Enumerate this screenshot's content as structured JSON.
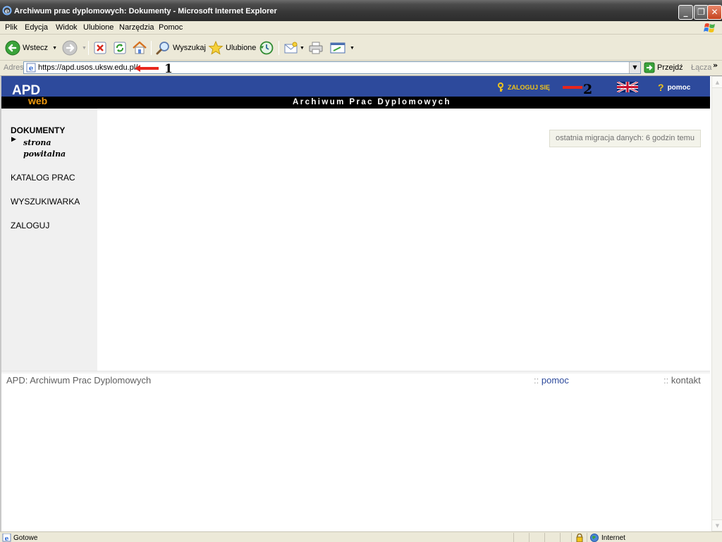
{
  "window": {
    "title": "Archiwum prac dyplomowych: Dokumenty - Microsoft Internet Explorer"
  },
  "menu": [
    "Plik",
    "Edycja",
    "Widok",
    "Ulubione",
    "Narzędzia",
    "Pomoc"
  ],
  "toolbar": {
    "back_label": "Wstecz",
    "search_label": "Wyszukaj",
    "favorites_label": "Ulubione"
  },
  "address": {
    "label": "Adres",
    "url": "https://apd.usos.uksw.edu.pl/",
    "go_label": "Przejdź",
    "links_label": "Łącza",
    "annotation_1": "1"
  },
  "page": {
    "logo_main": "APD",
    "logo_sub": "web",
    "tagline": "Archiwum Prac Dyplomowych",
    "login_label": "ZALOGUJ SIĘ",
    "annotation_2": "2",
    "help_label": "pomoc",
    "nav": {
      "dokumenty": "DOKUMENTY",
      "sub_item": "strona powitalna",
      "katalog": "KATALOG PRAC",
      "wyszukiwarka": "WYSZUKIWARKA",
      "zaloguj": "ZALOGUJ"
    },
    "migration_notice": "ostatnia migracja danych: 6 godzin temu",
    "footer": {
      "title": "APD: Archiwum Prac Dyplomowych",
      "sep": "::",
      "help": "pomoc",
      "contact": "kontakt"
    }
  },
  "status": {
    "text": "Gotowe",
    "zone": "Internet"
  },
  "colors": {
    "header_blue": "#2d4a9c",
    "logo_orange": "#f29b0e",
    "login_yellow": "#f0c419",
    "annotation_red": "#e8261c"
  }
}
